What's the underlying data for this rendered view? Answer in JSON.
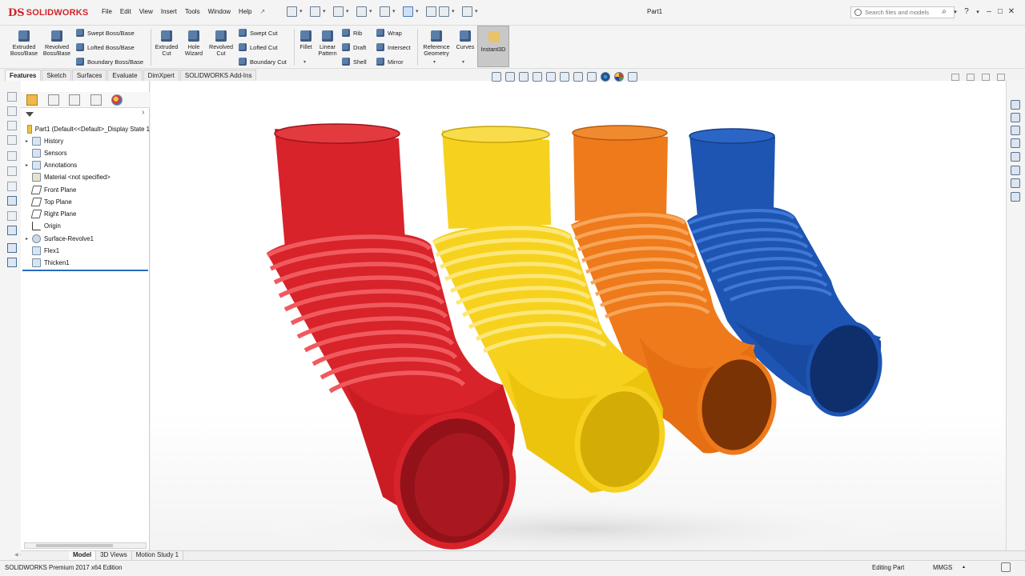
{
  "app": {
    "brand": "SOLIDWORKS",
    "brand_mark": "DS",
    "document_title": "Part1",
    "search_placeholder": "Search files and models"
  },
  "menu": [
    "File",
    "Edit",
    "View",
    "Insert",
    "Tools",
    "Window",
    "Help"
  ],
  "ribbon": {
    "extruded_boss": "Extruded Boss/Base",
    "revolved_boss": "Revolved Boss/Base",
    "swept_boss": "Swept Boss/Base",
    "lofted_boss": "Lofted Boss/Base",
    "boundary_boss": "Boundary Boss/Base",
    "extruded_cut": "Extruded Cut",
    "hole_wizard": "Hole Wizard",
    "revolved_cut": "Revolved Cut",
    "swept_cut": "Swept Cut",
    "lofted_cut": "Lofted Cut",
    "boundary_cut": "Boundary Cut",
    "fillet": "Fillet",
    "linear_pattern": "Linear Pattern",
    "rib": "Rib",
    "draft": "Draft",
    "shell": "Shell",
    "wrap": "Wrap",
    "intersect": "Intersect",
    "mirror": "Mirror",
    "reference_geometry": "Reference Geometry",
    "curves": "Curves",
    "instant3d": "Instant3D"
  },
  "tabs": [
    "Features",
    "Sketch",
    "Surfaces",
    "Evaluate",
    "DimXpert",
    "SOLIDWORKS Add-Ins"
  ],
  "tree": {
    "root": "Part1  (Default<<Default>_Display State 1",
    "items": [
      {
        "label": "History",
        "expandable": true
      },
      {
        "label": "Sensors",
        "expandable": false
      },
      {
        "label": "Annotations",
        "expandable": true
      },
      {
        "label": "Material <not specified>",
        "expandable": false
      },
      {
        "label": "Front Plane",
        "expandable": false
      },
      {
        "label": "Top Plane",
        "expandable": false
      },
      {
        "label": "Right Plane",
        "expandable": false
      },
      {
        "label": "Origin",
        "expandable": false
      },
      {
        "label": "Surface-Revolve1",
        "expandable": true
      },
      {
        "label": "Flex1",
        "expandable": false
      },
      {
        "label": "Thicken1",
        "expandable": false
      }
    ]
  },
  "bottom_tabs": [
    "Model",
    "3D Views",
    "Motion Study 1"
  ],
  "status": {
    "edition": "SOLIDWORKS Premium 2017 x64 Edition",
    "mode": "Editing Part",
    "units": "MMGS"
  },
  "model": {
    "part_colors": [
      "#d8232a",
      "#f6d21f",
      "#ee7a1b",
      "#1e55b3"
    ]
  }
}
